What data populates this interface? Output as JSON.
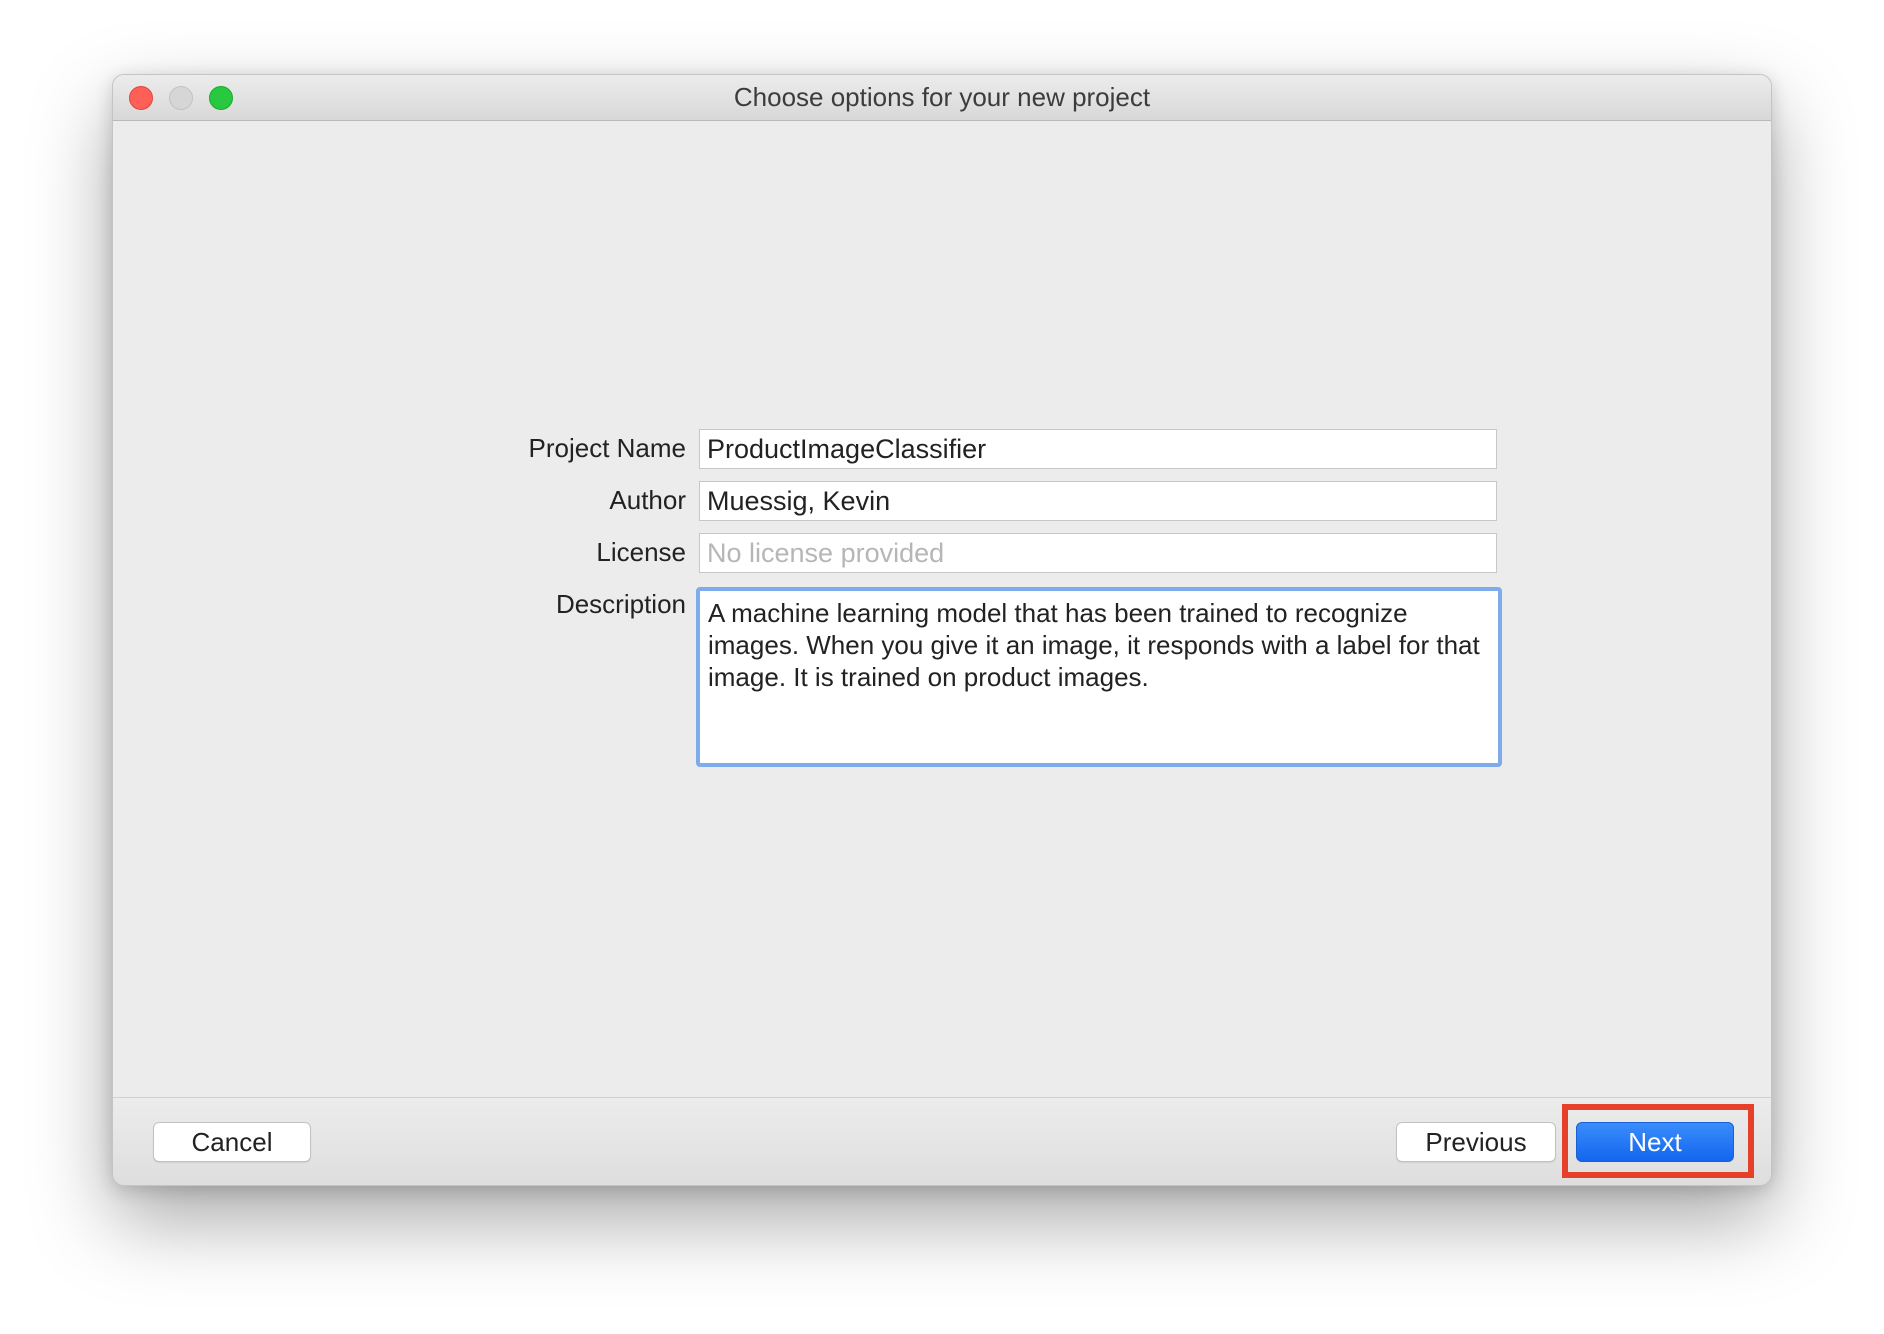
{
  "window": {
    "title": "Choose options for your new project"
  },
  "form": {
    "project_name": {
      "label": "Project Name",
      "value": "ProductImageClassifier"
    },
    "author": {
      "label": "Author",
      "value": "Muessig, Kevin"
    },
    "license": {
      "label": "License",
      "value": "",
      "placeholder": "No license provided"
    },
    "description": {
      "label": "Description",
      "value": "A machine learning model that has been trained to recognize images. When you give it an image, it responds with a label for that image. It is trained on product images."
    }
  },
  "footer": {
    "cancel_label": "Cancel",
    "previous_label": "Previous",
    "next_label": "Next"
  },
  "colors": {
    "window_bg": "#ececec",
    "focus_ring": "#7faaeb",
    "primary_button": "#1f6ff2",
    "highlight": "#e6402a",
    "close": "#fe5f57",
    "minimize": "#d6d6d6",
    "zoom": "#28c840"
  }
}
